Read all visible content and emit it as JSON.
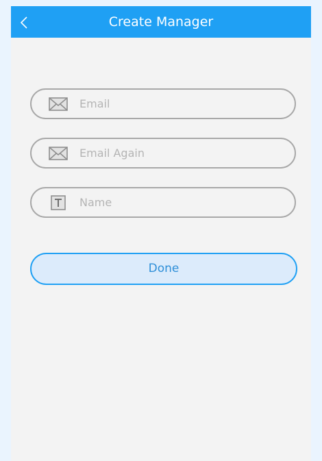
{
  "header": {
    "title": "Create Manager",
    "back_icon": "chevron-left-icon"
  },
  "form": {
    "email": {
      "placeholder": "Email",
      "value": "",
      "icon": "envelope-icon"
    },
    "email_again": {
      "placeholder": "Email Again",
      "value": "",
      "icon": "envelope-icon"
    },
    "name": {
      "placeholder": "Name",
      "value": "",
      "icon": "text-icon"
    },
    "done_label": "Done"
  },
  "colors": {
    "accent": "#1fa0f4",
    "screen_bg": "#f3f3f3",
    "page_bg": "#eaf4fe",
    "button_bg": "#dcebfb",
    "button_text": "#2f8fd8",
    "field_border": "#a8a8a8",
    "placeholder": "#b4b4b4"
  }
}
